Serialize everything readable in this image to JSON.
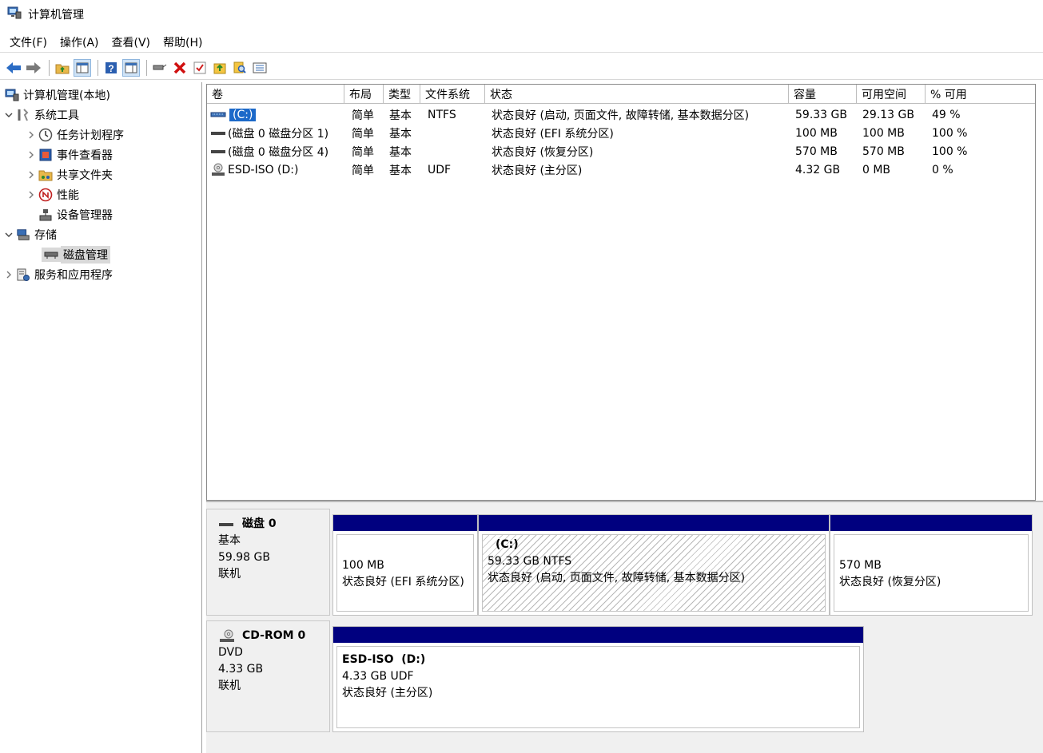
{
  "window": {
    "title": "计算机管理"
  },
  "menu": [
    "文件(F)",
    "操作(A)",
    "查看(V)",
    "帮助(H)"
  ],
  "tree": {
    "root": "计算机管理(本地)",
    "system_tools": "系统工具",
    "task_scheduler": "任务计划程序",
    "event_viewer": "事件查看器",
    "shared_folders": "共享文件夹",
    "performance": "性能",
    "device_manager": "设备管理器",
    "storage": "存储",
    "disk_management": "磁盘管理",
    "services_apps": "服务和应用程序"
  },
  "table": {
    "headers": [
      "卷",
      "布局",
      "类型",
      "文件系统",
      "状态",
      "容量",
      "可用空间",
      "% 可用"
    ],
    "rows": [
      [
        "(C:)",
        "简单",
        "基本",
        "NTFS",
        "状态良好 (启动, 页面文件, 故障转储, 基本数据分区)",
        "59.33 GB",
        "29.13 GB",
        "49 %"
      ],
      [
        "(磁盘 0 磁盘分区 1)",
        "简单",
        "基本",
        "",
        "状态良好 (EFI 系统分区)",
        "100 MB",
        "100 MB",
        "100 %"
      ],
      [
        "(磁盘 0 磁盘分区 4)",
        "简单",
        "基本",
        "",
        "状态良好 (恢复分区)",
        "570 MB",
        "570 MB",
        "100 %"
      ],
      [
        "ESD-ISO (D:)",
        "简单",
        "基本",
        "UDF",
        "状态良好 (主分区)",
        "4.32 GB",
        "0 MB",
        "0 %"
      ]
    ]
  },
  "disk0": {
    "name": "磁盘 0",
    "type": "基本",
    "size": "59.98 GB",
    "status": "联机",
    "partitions": [
      {
        "size": "100 MB",
        "status": "状态良好 (EFI 系统分区)"
      },
      {
        "name": "(C:)",
        "size": "59.33 GB NTFS",
        "status": "状态良好 (启动, 页面文件, 故障转储, 基本数据分区)"
      },
      {
        "size": "570 MB",
        "status": "状态良好 (恢复分区)"
      }
    ]
  },
  "cdrom0": {
    "name": "CD-ROM 0",
    "type": "DVD",
    "size": "4.33 GB",
    "status": "联机",
    "partition": {
      "name": "ESD-ISO  (D:)",
      "size": "4.33 GB UDF",
      "status": "状态良好 (主分区)"
    }
  }
}
